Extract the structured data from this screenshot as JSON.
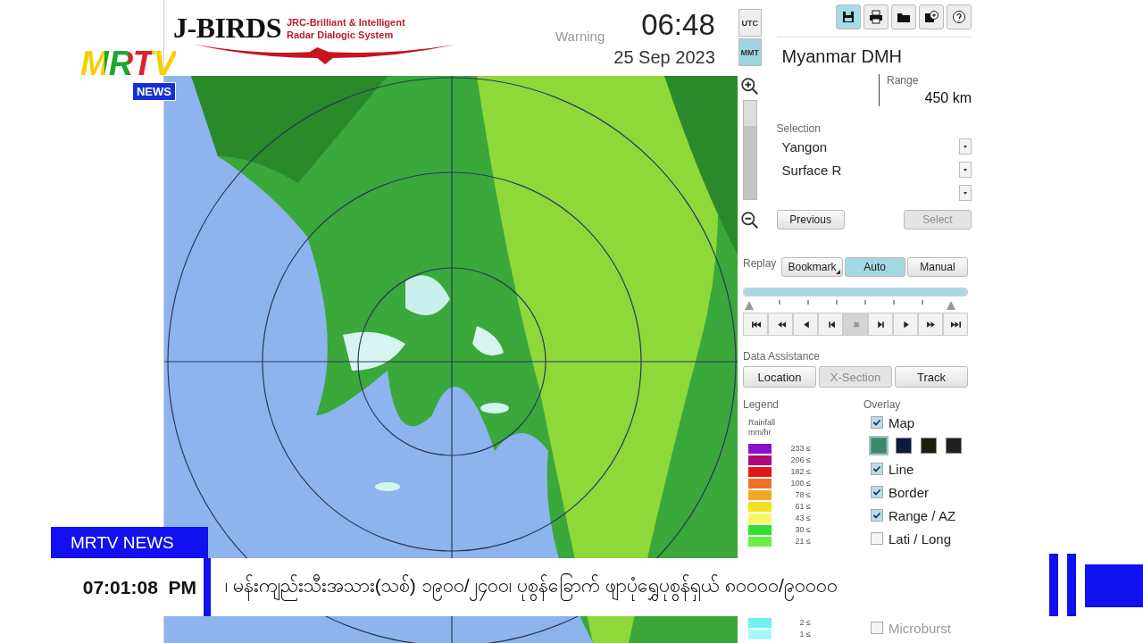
{
  "app": {
    "logo_title": "J-BIRDS",
    "logo_subtitle": [
      "JRC-Brilliant & Intelligent",
      "Radar Dialogic System"
    ],
    "warning": "Warning",
    "time": "06:48",
    "date": "25 Sep 2023",
    "time_zones": [
      {
        "label": "UTC",
        "selected": false
      },
      {
        "label": "MMT",
        "selected": true
      }
    ],
    "zoom": {
      "level": 0.75
    },
    "toolbar": [
      {
        "kind": "save",
        "selected": true
      },
      {
        "kind": "print",
        "selected": false
      },
      {
        "kind": "folder",
        "selected": false
      },
      {
        "kind": "add",
        "selected": false
      },
      {
        "kind": "help",
        "selected": false
      }
    ],
    "station": "Myanmar DMH",
    "range_label": "Range",
    "range_value": "450 km",
    "selection_label": "Selection",
    "dropdowns": [
      {
        "value": "Yangon"
      },
      {
        "value": "Surface R"
      }
    ],
    "selection_buttons": [
      {
        "label": "Previous",
        "disabled": false
      },
      {
        "label": "Select",
        "disabled": true
      }
    ],
    "replay": {
      "label": "Replay",
      "modes": [
        {
          "label": "Bookmark",
          "selected": false,
          "menu": true
        },
        {
          "label": "Auto",
          "selected": true,
          "menu": false
        },
        {
          "label": "Manual",
          "selected": false,
          "menu": false
        }
      ],
      "slider": {
        "level": 1.0
      },
      "controls": [
        {
          "kind": "first",
          "selected": false
        },
        {
          "kind": "rewind",
          "selected": false
        },
        {
          "kind": "back",
          "selected": false
        },
        {
          "kind": "step-back",
          "selected": false
        },
        {
          "kind": "stop",
          "selected": true
        },
        {
          "kind": "step-forward",
          "selected": false
        },
        {
          "kind": "play",
          "selected": false
        },
        {
          "kind": "forward",
          "selected": false
        },
        {
          "kind": "last",
          "selected": false
        }
      ]
    },
    "data_assistance": {
      "label": "Data Assistance",
      "buttons": [
        {
          "label": "Location",
          "disabled": false
        },
        {
          "label": "X-Section",
          "disabled": true
        },
        {
          "label": "Track",
          "disabled": false
        }
      ]
    },
    "legend": {
      "label": "Legend",
      "unit": [
        "Rainfall",
        "mm/hr"
      ],
      "entries": [
        {
          "value": "233 ≤",
          "color": "#8a10c8"
        },
        {
          "value": "206 ≤",
          "color": "#b0087a"
        },
        {
          "value": "182 ≤",
          "color": "#e01818"
        },
        {
          "value": "100 ≤",
          "color": "#f07028"
        },
        {
          "value": "78 ≤",
          "color": "#f0a828"
        },
        {
          "value": "61 ≤",
          "color": "#f0e020"
        },
        {
          "value": "43 ≤",
          "color": "#f8f860"
        },
        {
          "value": "30 ≤",
          "color": "#30e030"
        },
        {
          "value": "21 ≤",
          "color": "#68f048"
        }
      ],
      "entries_lower": [
        {
          "value": "2 ≤",
          "color": "#70f0f0"
        },
        {
          "value": "1 ≤",
          "color": "#a8f8f8"
        }
      ]
    },
    "overlay": {
      "label": "Overlay",
      "items": [
        {
          "kind": "check",
          "label": "Map",
          "checked": true
        },
        {
          "kind": "swatches",
          "swatches": [
            {
              "color": "#3a8a6a",
              "selected": true
            },
            {
              "color": "#0a1a40",
              "selected": false
            },
            {
              "color": "#1a2010",
              "selected": false
            },
            {
              "color": "#202020",
              "selected": false
            }
          ]
        },
        {
          "kind": "check",
          "label": "Line",
          "checked": true
        },
        {
          "kind": "check",
          "label": "Border",
          "checked": true
        },
        {
          "kind": "check",
          "label": "Range / AZ",
          "checked": true
        },
        {
          "kind": "check",
          "label": "Lati / Long",
          "checked": false
        }
      ],
      "items_lower": [
        {
          "kind": "check",
          "label": "Microburst",
          "checked": false
        }
      ]
    }
  },
  "broadcast": {
    "logo": "MRTV",
    "logo_badge": "NEWS",
    "channel_label": "MRTV NEWS",
    "clock": "07:01:08  PM",
    "ticker": "၊ မန်းကျည်းသီးအသား(သစ်) ၁၉၀၀/၂၄၀၀၊ ပုစွန်ခြောက် ဖျာပုံရွှေပုစွန်ရှယ် ၈၀၀၀၀/၉၀၀၀၀"
  }
}
